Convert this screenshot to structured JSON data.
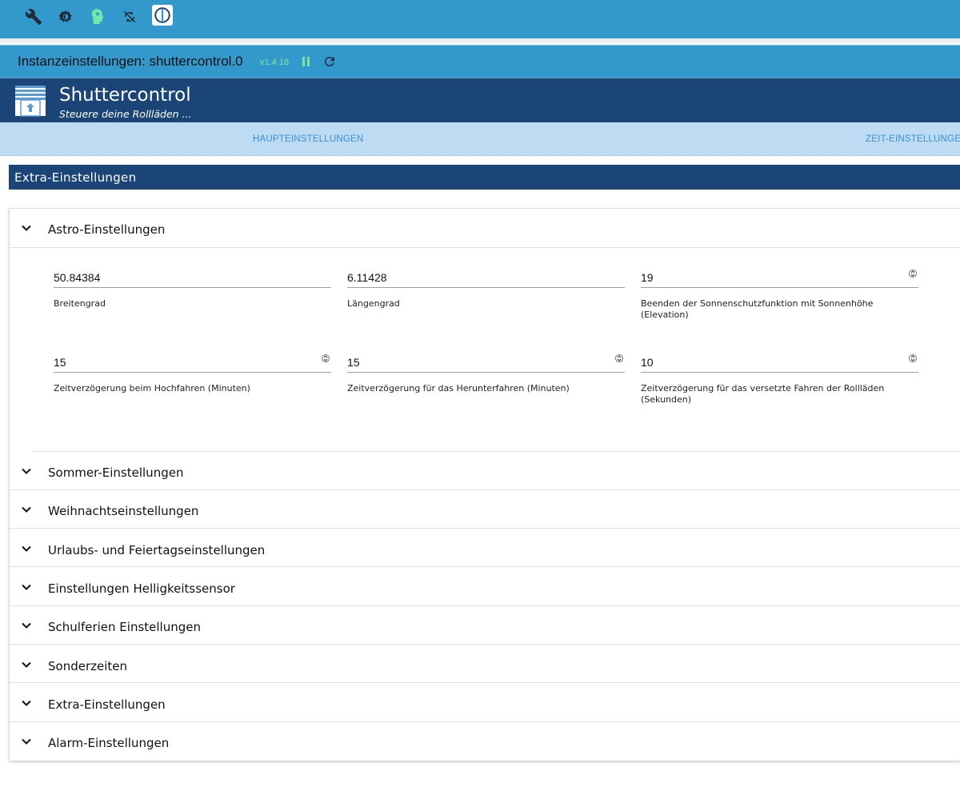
{
  "topbar": {
    "icons": [
      "wrench-icon",
      "gear-icon",
      "head-icon",
      "sync-off-icon",
      "iobroker-logo-icon"
    ]
  },
  "instance": {
    "title": "Instanzeinstellungen: shuttercontrol.0",
    "version": "v1.4.18"
  },
  "adapter": {
    "title": "Shuttercontrol",
    "subtitle": "Steuere deine Rollläden ..."
  },
  "tabs": {
    "main": "HAUPTEINSTELLUNGEN",
    "time": "ZEIT-EINSTELLUNGEN"
  },
  "section": {
    "title": "Extra-Einstellungen"
  },
  "astro": {
    "header": "Astro-Einstellungen",
    "fields": [
      {
        "value": "50.84384",
        "label": "Breitengrad"
      },
      {
        "value": "6.11428",
        "label": "Längengrad"
      },
      {
        "value": "19",
        "label": "Beenden der Sonnenschutzfunktion mit Sonnenhöhe (Elevation)"
      },
      {
        "value": "15",
        "label": "Zeitverzögerung beim Hochfahren (Minuten)"
      },
      {
        "value": "15",
        "label": "Zeitverzögerung für das Herunterfahren (Minuten)"
      },
      {
        "value": "10",
        "label": "Zeitverzögerung für das versetzte Fahren der Rollläden (Sekunden)"
      }
    ]
  },
  "panels": [
    "Sommer-Einstellungen",
    "Weihnachtseinstellungen",
    "Urlaubs- und Feiertagseinstellungen",
    "Einstellungen Helligkeitssensor",
    "Schulferien Einstellungen",
    "Sonderzeiten",
    "Extra-Einstellungen",
    "Alarm-Einstellungen"
  ],
  "colors": {
    "topbar": "#3399cc",
    "header": "#1a4576",
    "tabbar": "#bddcf3",
    "tab_text": "#3b8fd0",
    "version": "#7ee59a"
  }
}
